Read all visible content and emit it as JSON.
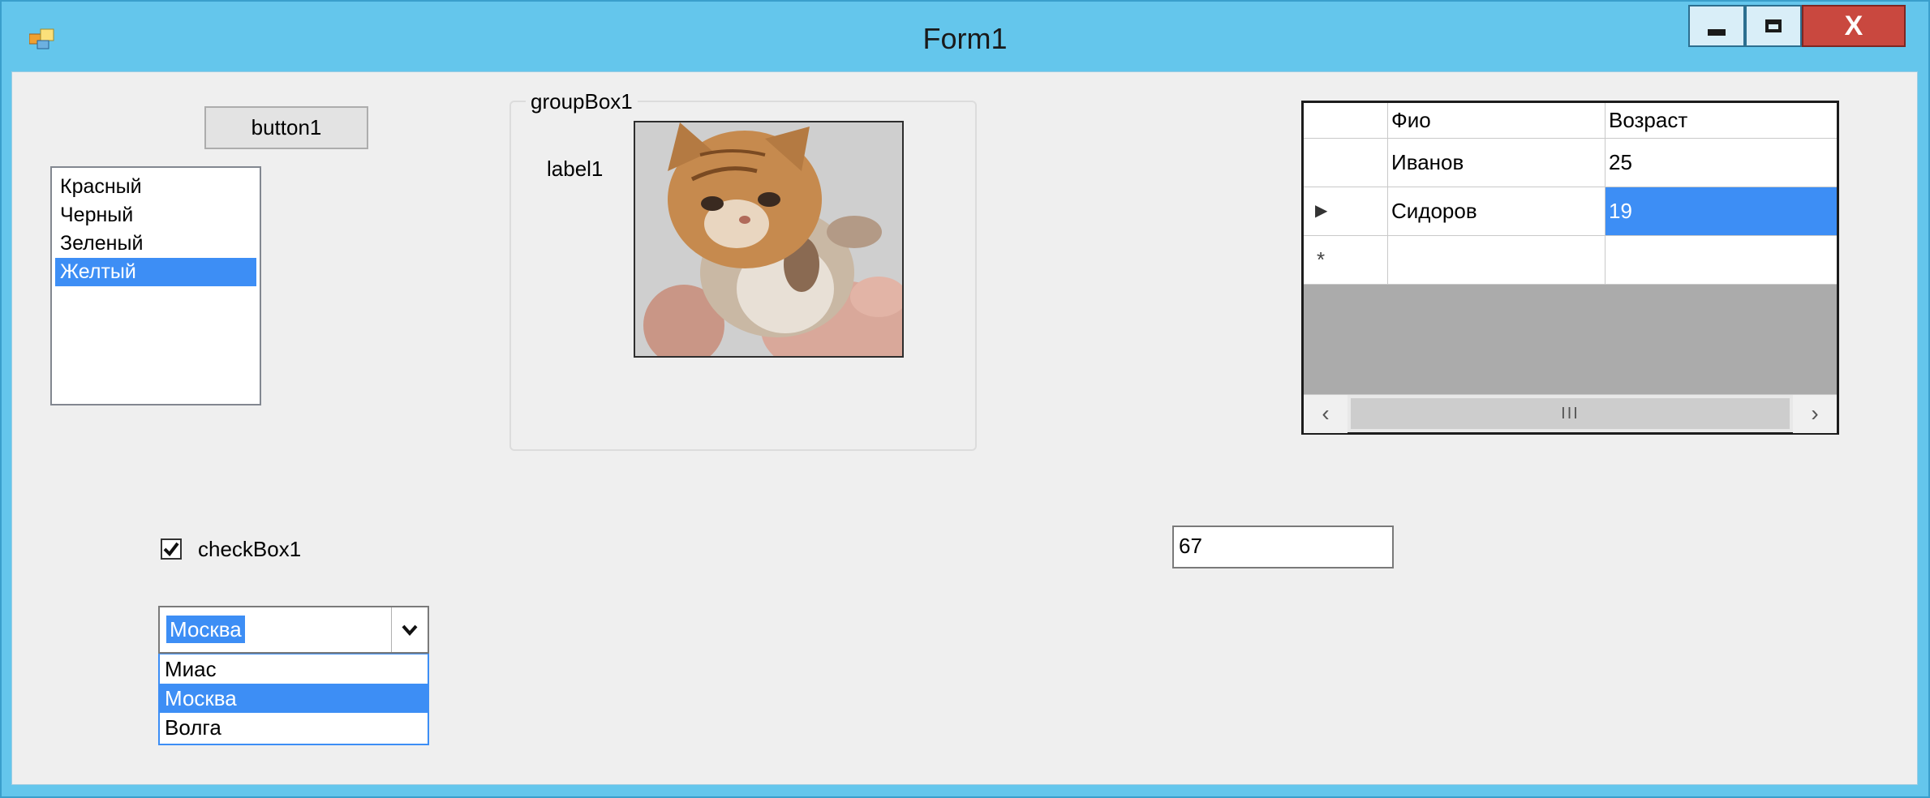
{
  "window": {
    "title": "Form1",
    "close_label": "X"
  },
  "button1": {
    "label": "button1"
  },
  "color_list": {
    "items": [
      "Красный",
      "Черный",
      "Зеленый",
      "Желтый"
    ],
    "selected_index": 3
  },
  "group_box": {
    "title": "groupBox1",
    "label": "label1"
  },
  "data_grid": {
    "columns": [
      "Фио",
      "Возраст"
    ],
    "rows": [
      {
        "name": "Иванов",
        "age": "25"
      },
      {
        "name": "Сидоров",
        "age": "19"
      }
    ],
    "current_row_index": 1,
    "new_row_marker": "*",
    "scroll_thumb_grip": "III"
  },
  "checkbox1": {
    "label": "checkBox1",
    "checked": true
  },
  "number_field": {
    "value": "67"
  },
  "city_combo": {
    "value": "Москва",
    "options": [
      "Миас",
      "Москва",
      "Волга"
    ],
    "selected_index": 1
  },
  "colors": {
    "accent": "#3d8ef5",
    "titlebar": "#64c6ec",
    "close": "#c9483f",
    "client": "#efefef"
  },
  "icons": [
    "app-icon",
    "minimize-icon",
    "maximize-icon",
    "checkmark-icon",
    "chevron-down-icon",
    "row-pointer-icon",
    "scroll-left-icon",
    "scroll-right-icon"
  ]
}
